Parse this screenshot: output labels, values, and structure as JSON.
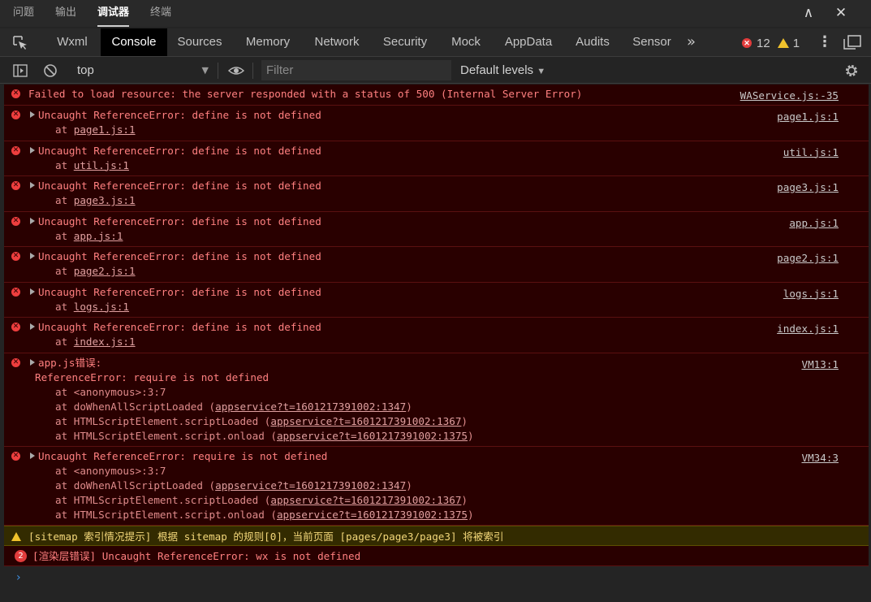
{
  "panel_tabs": [
    "问题",
    "输出",
    "调试器",
    "终端"
  ],
  "panel_active": "调试器",
  "window": {
    "collapse_glyph": "∧",
    "close_glyph": "✕"
  },
  "devtools_tabs": [
    "Wxml",
    "Console",
    "Sources",
    "Memory",
    "Network",
    "Security",
    "Mock",
    "AppData",
    "Audits",
    "Sensor"
  ],
  "devtools_active": "Console",
  "more_tabs_glyph": "»",
  "counts": {
    "errors": "12",
    "warnings": "1"
  },
  "toolbar": {
    "context": "top",
    "filter_placeholder": "Filter",
    "levels": "Default levels"
  },
  "messages": [
    {
      "kind": "plain",
      "text": "Failed to load resource: the server responded with a status of 500 (Internal Server Error)",
      "source": "WAService.js:-35"
    },
    {
      "kind": "ref",
      "text": "Uncaught ReferenceError: define is not defined",
      "frame_at": "at",
      "frame_link": "page1.js:1",
      "source": "page1.js:1"
    },
    {
      "kind": "ref",
      "text": "Uncaught ReferenceError: define is not defined",
      "frame_at": "at",
      "frame_link": "util.js:1",
      "source": "util.js:1"
    },
    {
      "kind": "ref",
      "text": "Uncaught ReferenceError: define is not defined",
      "frame_at": "at",
      "frame_link": "page3.js:1",
      "source": "page3.js:1"
    },
    {
      "kind": "ref",
      "text": "Uncaught ReferenceError: define is not defined",
      "frame_at": "at",
      "frame_link": "app.js:1",
      "source": "app.js:1"
    },
    {
      "kind": "ref",
      "text": "Uncaught ReferenceError: define is not defined",
      "frame_at": "at",
      "frame_link": "page2.js:1",
      "source": "page2.js:1"
    },
    {
      "kind": "ref",
      "text": "Uncaught ReferenceError: define is not defined",
      "frame_at": "at",
      "frame_link": "logs.js:1",
      "source": "logs.js:1"
    },
    {
      "kind": "ref",
      "text": "Uncaught ReferenceError: define is not defined",
      "frame_at": "at",
      "frame_link": "index.js:1",
      "source": "index.js:1"
    }
  ],
  "appjs_error": {
    "title": "app.js错误:",
    "detail": "ReferenceError: require is not defined",
    "source": "VM13:1",
    "frames": [
      {
        "pre": "at <anonymous>:3:7",
        "link": ""
      },
      {
        "pre": "at doWhenAllScriptLoaded (",
        "link": "appservice?t=1601217391002:1347",
        "post": ")"
      },
      {
        "pre": "at HTMLScriptElement.scriptLoaded (",
        "link": "appservice?t=1601217391002:1367",
        "post": ")"
      },
      {
        "pre": "at HTMLScriptElement.script.onload (",
        "link": "appservice?t=1601217391002:1375",
        "post": ")"
      }
    ]
  },
  "require_error": {
    "title": "Uncaught ReferenceError: require is not defined",
    "source": "VM34:3",
    "frames": [
      {
        "pre": "at <anonymous>:3:7",
        "link": ""
      },
      {
        "pre": "at doWhenAllScriptLoaded (",
        "link": "appservice?t=1601217391002:1347",
        "post": ")"
      },
      {
        "pre": "at HTMLScriptElement.scriptLoaded (",
        "link": "appservice?t=1601217391002:1367",
        "post": ")"
      },
      {
        "pre": "at HTMLScriptElement.script.onload (",
        "link": "appservice?t=1601217391002:1375",
        "post": ")"
      }
    ]
  },
  "warning": {
    "text": "[sitemap 索引情况提示] 根据 sitemap 的规则[0]，当前页面 [pages/page3/page3] 将被索引"
  },
  "render_error": {
    "count": "2",
    "text": "[渲染层错误] Uncaught ReferenceError: wx is not defined"
  },
  "prompt_glyph": "›",
  "colors": {
    "error_bg": "#290000",
    "error_text": "#ff8080",
    "warn_bg": "#332b00",
    "accent": "#3d8ee0"
  },
  "icons": [
    "inspect-icon",
    "dock-icon",
    "sidebar-toggle-icon",
    "clear-icon",
    "eye-icon",
    "gear-icon",
    "error-icon",
    "warning-icon",
    "expand-triangle-icon"
  ]
}
